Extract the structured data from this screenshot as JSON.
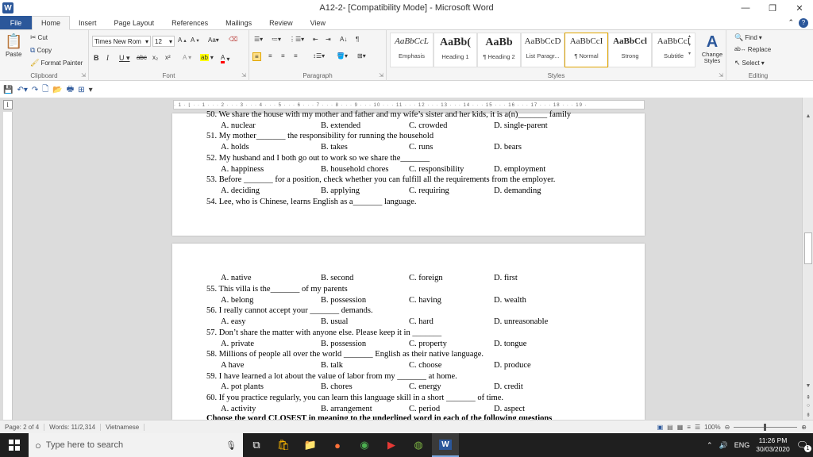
{
  "window": {
    "title": "A12-2- [Compatibility Mode] - Microsoft Word",
    "app_logo": "W"
  },
  "tabs": [
    "File",
    "Home",
    "Insert",
    "Page Layout",
    "References",
    "Mailings",
    "Review",
    "View"
  ],
  "clipboard": {
    "paste": "Paste",
    "cut": "Cut",
    "copy": "Copy",
    "format_painter": "Format Painter",
    "label": "Clipboard"
  },
  "font": {
    "name": "Times New Rom",
    "size": "12",
    "label": "Font"
  },
  "paragraph": {
    "label": "Paragraph"
  },
  "styles": {
    "label": "Styles",
    "items": [
      {
        "sample": "AaBbCcL",
        "name": "Emphasis"
      },
      {
        "sample": "AaBb(",
        "name": "Heading 1"
      },
      {
        "sample": "AaBb",
        "name": "¶ Heading 2"
      },
      {
        "sample": "AaBbCcD",
        "name": "List Paragr..."
      },
      {
        "sample": "AaBbCcI",
        "name": "¶ Normal"
      },
      {
        "sample": "AaBbCcl",
        "name": "Strong"
      },
      {
        "sample": "AaBbCcI",
        "name": "Subtitle"
      }
    ],
    "change_styles": "Change Styles"
  },
  "editing": {
    "find": "Find",
    "replace": "Replace",
    "select": "Select",
    "label": "Editing"
  },
  "ruler": {
    "marks": "· 1 · ⌊ · · 1 · · · 2 · · · 3 · · · 4 · · · 5 · · · 6 · · · 7 · · · 8 · · · 9 · · · 10 · · · 11 · · · 12 · · · 13 · · · 14 · · · 15 · · · 16 · · · 17 · · · 18 · · · 19 ·"
  },
  "page1": {
    "lines": [
      {
        "text": "50. We share the house with my mother and father and my wife’s sister and her kids, it is a(n)_______ family",
        "opts": [
          "A. nuclear",
          "B. extended",
          "C. crowded",
          "D. single-parent"
        ]
      },
      {
        "text": "51. My mother_______ the responsibility for running the household",
        "opts": [
          "A. holds",
          "B. takes",
          "C. runs",
          "D. bears"
        ]
      },
      {
        "text": "52. My husband and I both go out to work so we share the_______",
        "opts": [
          "A. happiness",
          "B. household chores",
          "C. responsibility",
          "D. employment"
        ]
      },
      {
        "text": "53. Before _______ for a position, check whether you can fulfill all the requirements from the employer.",
        "opts": [
          "A. deciding",
          "B. applying",
          "C. requiring",
          "D. demanding"
        ]
      },
      {
        "text": "54. Lee, who is Chinese, learns English as a_______ language.",
        "opts": []
      }
    ]
  },
  "page2": {
    "first_opts": [
      "A. native",
      "B. second",
      "C. foreign",
      "D. first"
    ],
    "lines": [
      {
        "text": "55. This villa is the_______ of my parents",
        "opts": [
          "A. belong",
          "B. possession",
          "C. having",
          "D. wealth"
        ]
      },
      {
        "text": "56. I really cannot accept your _______ demands.",
        "opts": [
          "A. easy",
          "B. usual",
          "C. hard",
          "D. unreasonable"
        ]
      },
      {
        "text": "57. Don’t share the matter with anyone else. Please keep it in _______",
        "opts": [
          "A. private",
          "B. possession",
          "C. property",
          "D. tongue"
        ]
      },
      {
        "text": "58. Millions of people all over the world _______ English as their native language.",
        "opts": [
          "A have",
          "B. talk",
          "C. choose",
          "D. produce"
        ]
      },
      {
        "text": "59. I have learned a lot about the value of labor from my _______ at home.",
        "opts": [
          "A. pot plants",
          "B. chores",
          "C. energy",
          "D. credit"
        ]
      },
      {
        "text": "60. If you practice regularly, you can learn this language skill in a short _______ of time.",
        "opts": [
          "A. activity",
          "B. arrangement",
          "C. period",
          "D. aspect"
        ]
      }
    ],
    "cut_heading": "Choose the word CLOSEST in meaning to the underlined word in each of the following questions"
  },
  "status": {
    "page": "Page: 2 of 4",
    "words": "Words: 11/2,314",
    "language": "Vietnamese",
    "zoom": "100%"
  },
  "taskbar": {
    "search_placeholder": "Type here to search",
    "lang": "ENG",
    "time": "11:26 PM",
    "date": "30/03/2020",
    "notif": "1"
  }
}
